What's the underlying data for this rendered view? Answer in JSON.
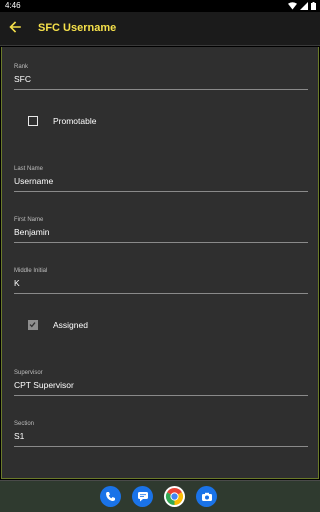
{
  "status_bar": {
    "time": "4:46",
    "icons": [
      "wifi-icon",
      "signal-icon",
      "battery-icon"
    ]
  },
  "app_bar": {
    "back_icon": "arrow-left-icon",
    "title": "SFC Username",
    "title_color": "#f5e04a"
  },
  "form": {
    "rank": {
      "label": "Rank",
      "value": "SFC"
    },
    "promotable": {
      "label": "Promotable",
      "checked": false
    },
    "last_name": {
      "label": "Last Name",
      "value": "Username"
    },
    "first_name": {
      "label": "First Name",
      "value": "Benjamin"
    },
    "middle_initial": {
      "label": "Middle Initial",
      "value": "K"
    },
    "assigned": {
      "label": "Assigned",
      "checked": true
    },
    "supervisor": {
      "label": "Supervisor",
      "value": "CPT Supervisor"
    },
    "section": {
      "label": "Section",
      "value": "S1"
    }
  },
  "dock": {
    "apps": [
      "phone-icon",
      "messages-icon",
      "chrome-icon",
      "camera-icon"
    ]
  }
}
